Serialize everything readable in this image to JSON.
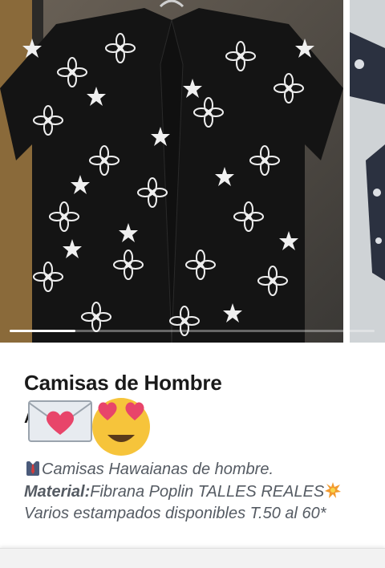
{
  "product": {
    "title": "Camisas de Hombre",
    "price_partial": "A",
    "description": {
      "line1": "Camisas Hawaianas de hombre.",
      "material_label": "Material:",
      "material_value": "Fibrana Poplin TALLES REALES",
      "rest": " Varios estampados disponibles T.50 al 60*"
    }
  },
  "carousel": {
    "progress_fraction": 0.18,
    "image_1": "black-hawaiian-shirt-white-floral-print",
    "image_2": "navy-floral-shirt-partial"
  },
  "icons": {
    "envelope_heart": "love-letter-icon",
    "heart_eyes": "heart-eyes-face-icon",
    "shirt_tie": "shirt-tie-icon",
    "collision": "collision-icon"
  },
  "colors": {
    "title": "#1a1a1a",
    "description": "#555b63",
    "shirt": "#1f1f1f"
  }
}
